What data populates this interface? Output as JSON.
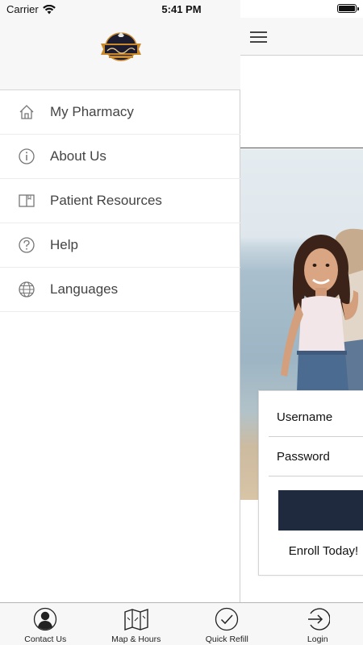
{
  "status_bar": {
    "carrier": "Carrier",
    "time": "5:41 PM"
  },
  "drawer": {
    "menu": [
      {
        "label": "My Pharmacy",
        "icon": "home-icon"
      },
      {
        "label": "About Us",
        "icon": "info-icon"
      },
      {
        "label": "Patient Resources",
        "icon": "book-icon"
      },
      {
        "label": "Help",
        "icon": "help-icon"
      },
      {
        "label": "Languages",
        "icon": "globe-icon"
      }
    ]
  },
  "login": {
    "username_placeholder": "Username",
    "password_placeholder": "Password",
    "enroll_text": "Enroll Today!"
  },
  "tab_bar": {
    "tabs": [
      {
        "label": "Contact Us",
        "icon": "person-icon"
      },
      {
        "label": "Map & Hours",
        "icon": "map-icon"
      },
      {
        "label": "Quick Refill",
        "icon": "checkmark-icon"
      },
      {
        "label": "Login",
        "icon": "login-icon"
      }
    ]
  },
  "colors": {
    "login_button": "#1f2a3e",
    "logo_badge": "#1c1c2e",
    "logo_banner": "#c9892d"
  }
}
